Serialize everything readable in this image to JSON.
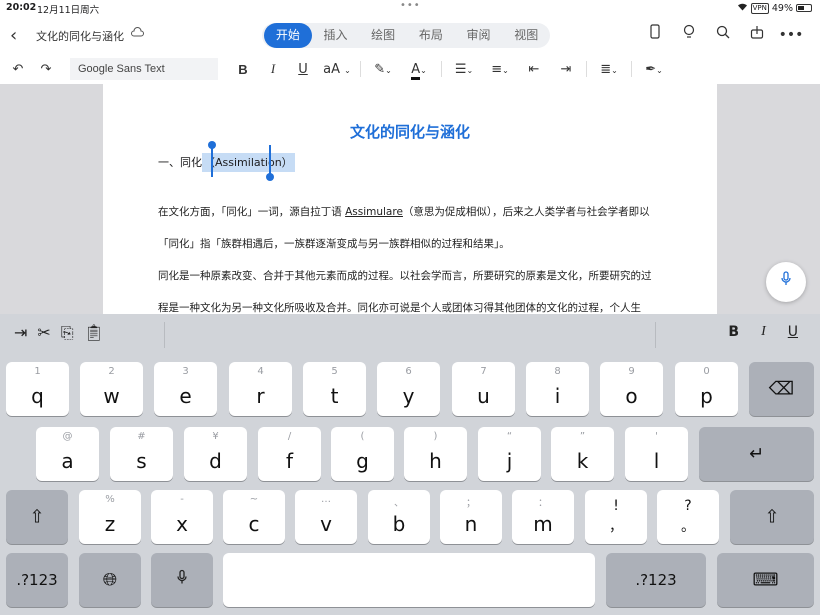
{
  "status": {
    "time": "20:02",
    "date": "12月11日周六",
    "dots": "•••",
    "vpn": "VPN",
    "battery": "49%"
  },
  "header": {
    "doc_title": "文化的同化与涵化",
    "tabs": [
      "开始",
      "插入",
      "绘图",
      "布局",
      "审阅",
      "视图"
    ],
    "active_tab": "开始"
  },
  "toolbar": {
    "font_name": "Google Sans Text",
    "bold": "B",
    "italic": "I",
    "underline": "U",
    "font_size": "aA"
  },
  "document": {
    "heading": "文化的同化与涵化",
    "section_prefix": "一、同化",
    "section_selected": "（Assimilation）",
    "para1_a": "在文化方面，「同化」一词，源自拉丁语 ",
    "para1_link": "Assimulare",
    "para1_b": "（意思为促成相似），后来之人类学者与社会学者即以",
    "para2": "「同化」指「族群相遇后，一族群逐渐变成与另一族群相似的过程和结果」。",
    "para3": "同化是一种原素改变、合并于其他元素而成的过程。以社会学而言，所要研究的原素是文化，所要研究的过",
    "para4": "程是一种文化为另一种文化所吸收及合并。同化亦可说是个人或团体习得其他团体的文化的过程，个人生"
  },
  "keyboard": {
    "shortcut_right": [
      "B",
      "I",
      "U"
    ],
    "row1": [
      {
        "hint": "1",
        "key": "q"
      },
      {
        "hint": "2",
        "key": "w"
      },
      {
        "hint": "3",
        "key": "e"
      },
      {
        "hint": "4",
        "key": "r"
      },
      {
        "hint": "5",
        "key": "t"
      },
      {
        "hint": "6",
        "key": "y"
      },
      {
        "hint": "7",
        "key": "u"
      },
      {
        "hint": "8",
        "key": "i"
      },
      {
        "hint": "9",
        "key": "o"
      },
      {
        "hint": "0",
        "key": "p"
      }
    ],
    "row2": [
      {
        "hint": "@",
        "key": "a"
      },
      {
        "hint": "#",
        "key": "s"
      },
      {
        "hint": "¥",
        "key": "d"
      },
      {
        "hint": "/",
        "key": "f"
      },
      {
        "hint": "(",
        "key": "g"
      },
      {
        "hint": ")",
        "key": "h"
      },
      {
        "hint": "“",
        "key": "j"
      },
      {
        "hint": "”",
        "key": "k"
      },
      {
        "hint": "'",
        "key": "l"
      }
    ],
    "row3": [
      {
        "hint": "%",
        "key": "z"
      },
      {
        "hint": "-",
        "key": "x"
      },
      {
        "hint": "~",
        "key": "c"
      },
      {
        "hint": "…",
        "key": "v"
      },
      {
        "hint": "、",
        "key": "b"
      },
      {
        "hint": "；",
        "key": "n"
      },
      {
        "hint": "：",
        "key": "m"
      },
      {
        "hint": "!",
        "key": "，"
      },
      {
        "hint": "?",
        "key": "。"
      }
    ],
    "num_label": ".?123",
    "num_label_right": ".?123"
  }
}
